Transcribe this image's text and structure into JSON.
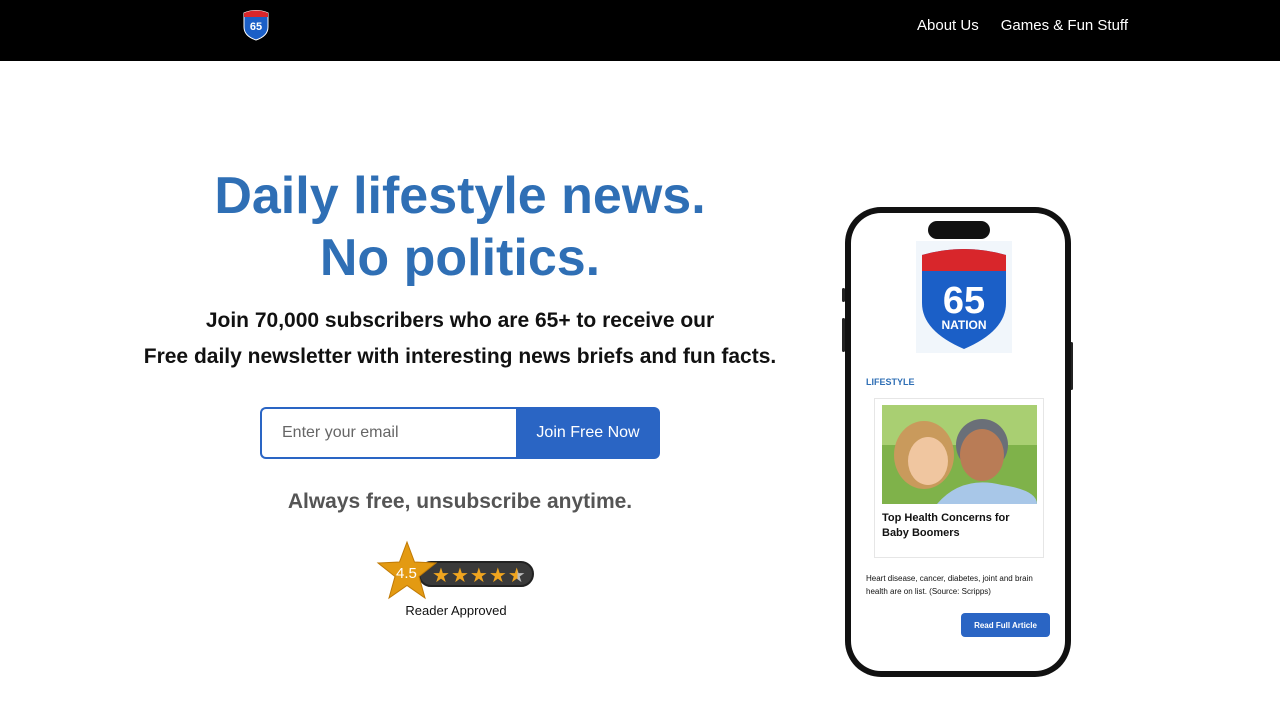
{
  "header": {
    "logo_text": "65",
    "nav": [
      {
        "label": "About Us"
      },
      {
        "label": "Games & Fun Stuff"
      }
    ]
  },
  "hero": {
    "headline_line1": "Daily lifestyle news.",
    "headline_line2": "No politics.",
    "sub_line1": "Join 70,000 subscribers who are 65+ to receive our",
    "sub_line2": "Free daily newsletter with interesting news briefs and fun facts."
  },
  "signup": {
    "email_placeholder": "Enter your email",
    "email_value": "",
    "button_label": "Join Free Now"
  },
  "free_note": "Always free, unsubscribe anytime.",
  "rating": {
    "score": "4.5",
    "stars_filled": 4.5,
    "stars_total": 5,
    "caption": "Reader Approved"
  },
  "phone": {
    "logo_number": "65",
    "logo_word": "NATION",
    "category": "LIFESTYLE",
    "article_title": "Top Health Concerns for Baby Boomers",
    "article_desc": "Heart disease, cancer, diabetes, joint and brain health are on list.  (Source: Scripps)",
    "read_button": "Read Full Article"
  },
  "colors": {
    "brand_blue": "#2f6fb5",
    "button_blue": "#2a65c4",
    "header_bg": "#000000",
    "star_gold": "#f0a51f"
  }
}
